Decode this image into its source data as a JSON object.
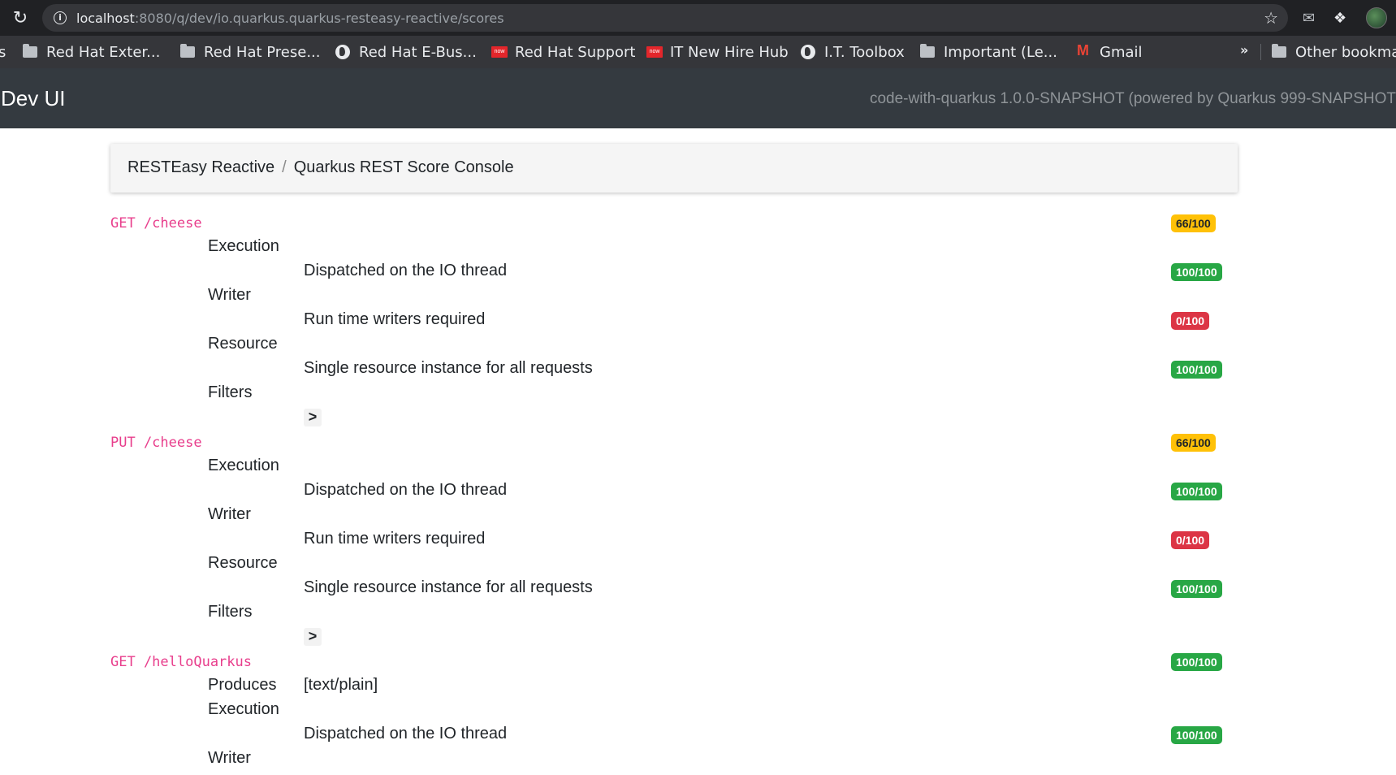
{
  "browser": {
    "url_host": "localhost",
    "url_path": ":8080/q/dev/io.quarkus.quarkus-resteasy-reactive/scores",
    "bookmarks": [
      {
        "label": "s",
        "icon": "none"
      },
      {
        "label": "Red Hat Exter...",
        "icon": "folder-icon"
      },
      {
        "label": "Red Hat Prese...",
        "icon": "folder-icon"
      },
      {
        "label": "Red Hat E-Bus...",
        "icon": "globe-icon"
      },
      {
        "label": "Red Hat Support",
        "icon": "now-icon"
      },
      {
        "label": "IT New Hire Hub",
        "icon": "now-icon"
      },
      {
        "label": "I.T. Toolbox",
        "icon": "globe-icon"
      },
      {
        "label": "Important (Le...",
        "icon": "folder-icon"
      },
      {
        "label": "Gmail",
        "icon": "gmail-icon"
      },
      {
        "label": "Other bookma",
        "icon": "folder-icon"
      }
    ],
    "overflow": "»",
    "now_badge": "now"
  },
  "header": {
    "title": "Dev UI",
    "version": "code-with-quarkus 1.0.0-SNAPSHOT (powered by Quarkus 999-SNAPSHOT"
  },
  "breadcrumb": {
    "parent": "RESTEasy Reactive",
    "separator": "/",
    "current": "Quarkus REST Score Console"
  },
  "endpoints": [
    {
      "method_path": "GET /cheese",
      "score": "66/100",
      "execution_label": "Execution",
      "execution_detail": "Dispatched on the IO thread",
      "execution_score": "100/100",
      "writer_label": "Writer",
      "writer_detail": "Run time writers required",
      "writer_score": "0/100",
      "resource_label": "Resource",
      "resource_detail": "Single resource instance for all requests",
      "resource_score": "100/100",
      "filters_label": "Filters",
      "expander": ">"
    },
    {
      "method_path": "PUT /cheese",
      "score": "66/100",
      "execution_label": "Execution",
      "execution_detail": "Dispatched on the IO thread",
      "execution_score": "100/100",
      "writer_label": "Writer",
      "writer_detail": "Run time writers required",
      "writer_score": "0/100",
      "resource_label": "Resource",
      "resource_detail": "Single resource instance for all requests",
      "resource_score": "100/100",
      "filters_label": "Filters",
      "expander": ">"
    },
    {
      "method_path": "GET /helloQuarkus",
      "score": "100/100",
      "produces_label": "Produces",
      "produces_detail": "[text/plain]",
      "execution_label": "Execution",
      "execution_detail": "Dispatched on the IO thread",
      "execution_score": "100/100",
      "writer_label": "Writer"
    }
  ],
  "colors": {
    "badge_success": "#28a745",
    "badge_warning": "#ffc107",
    "badge_danger": "#dc3545",
    "endpoint": "#e83e8c",
    "header_bg": "#343a40"
  }
}
